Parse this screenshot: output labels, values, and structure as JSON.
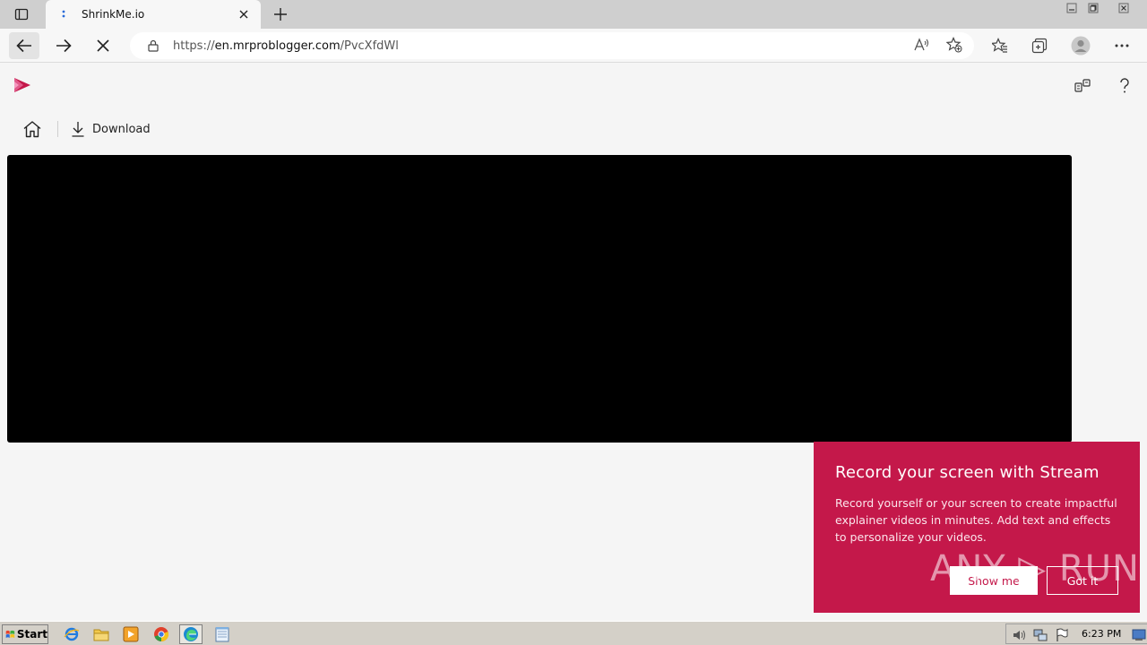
{
  "browser": {
    "tab": {
      "title": "ShrinkMe.io"
    },
    "address": {
      "scheme": "https://",
      "host": "en.mrproblogger.com",
      "path": "/PvcXfdWl"
    }
  },
  "page": {
    "command_bar": {
      "download_label": "Download"
    }
  },
  "popup": {
    "title": "Record your screen with Stream",
    "body": "Record yourself or your screen to create impactful explainer videos in minutes. Add text and effects to personalize your videos.",
    "show_me_label": "Show me",
    "got_it_label": "Got it"
  },
  "watermark": {
    "text": "ANY ▷ RUN"
  },
  "taskbar": {
    "start_label": "Start",
    "clock": "6:23 PM"
  },
  "colors": {
    "popup_bg": "#c4184a",
    "video_bg": "#000000",
    "logo_accent": "#c4184a"
  }
}
